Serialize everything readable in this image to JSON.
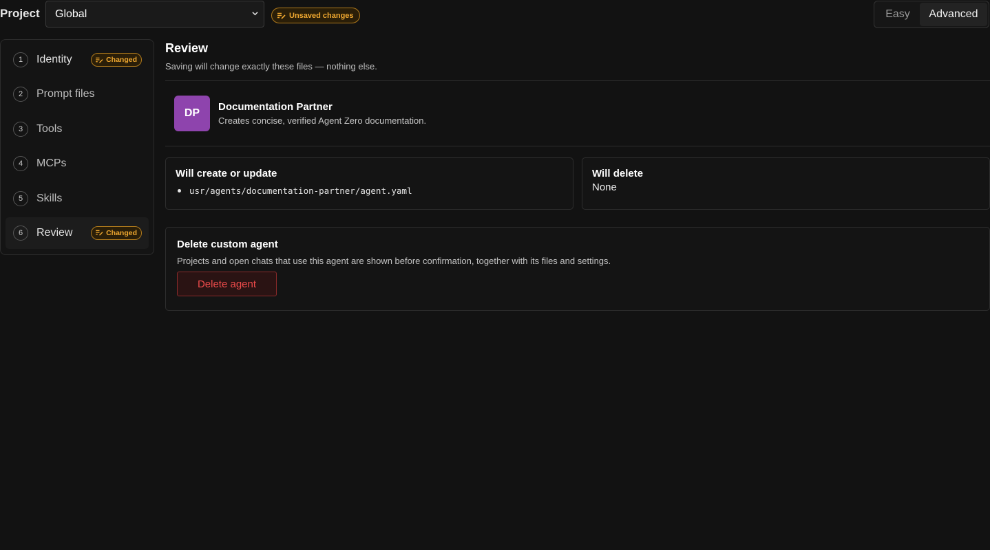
{
  "header": {
    "project_label": "Project",
    "project_value": "Global",
    "unsaved_badge": "Unsaved changes",
    "mode": {
      "easy": "Easy",
      "advanced": "Advanced",
      "selected": "Advanced"
    }
  },
  "sidebar": {
    "items": [
      {
        "num": "1",
        "label": "Identity",
        "badge": "Changed"
      },
      {
        "num": "2",
        "label": "Prompt files",
        "badge": ""
      },
      {
        "num": "3",
        "label": "Tools",
        "badge": ""
      },
      {
        "num": "4",
        "label": "MCPs",
        "badge": ""
      },
      {
        "num": "5",
        "label": "Skills",
        "badge": ""
      },
      {
        "num": "6",
        "label": "Review",
        "badge": "Changed"
      }
    ],
    "active_index": 5
  },
  "review": {
    "title": "Review",
    "subtitle": "Saving will change exactly these files — nothing else."
  },
  "agent": {
    "initials": "DP",
    "name": "Documentation Partner",
    "description": "Creates concise, verified Agent Zero documentation.",
    "avatar_color": "#8e44ad"
  },
  "changes": {
    "create_title": "Will create or update",
    "create_files": [
      "usr/agents/documentation-partner/agent.yaml"
    ],
    "delete_title": "Will delete",
    "delete_value": "None"
  },
  "danger": {
    "title": "Delete custom agent",
    "description": "Projects and open chats that use this agent are shown before confirmation, together with its files and settings.",
    "button_label": "Delete agent"
  },
  "colors": {
    "background": "#121212",
    "accent_warning": "#f0a830",
    "danger": "#ef4b4b"
  }
}
